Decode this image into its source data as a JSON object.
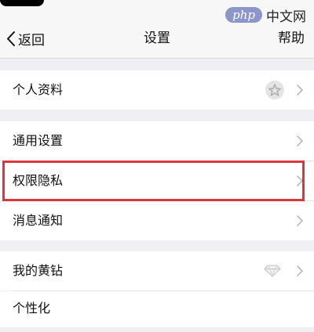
{
  "watermark": {
    "logo_text": "php",
    "site_text": "中文网"
  },
  "nav": {
    "back_label": "返回",
    "title": "设置",
    "help_label": "帮助"
  },
  "sections": {
    "profile": {
      "label": "个人资料"
    },
    "general": {
      "label": "通用设置"
    },
    "privacy": {
      "label": "权限隐私"
    },
    "notifications": {
      "label": "消息通知"
    },
    "vip": {
      "label": "我的黄钻"
    },
    "personalize": {
      "label": "个性化"
    }
  },
  "colors": {
    "highlight_border": "#d9363e",
    "background": "#efeff4"
  }
}
